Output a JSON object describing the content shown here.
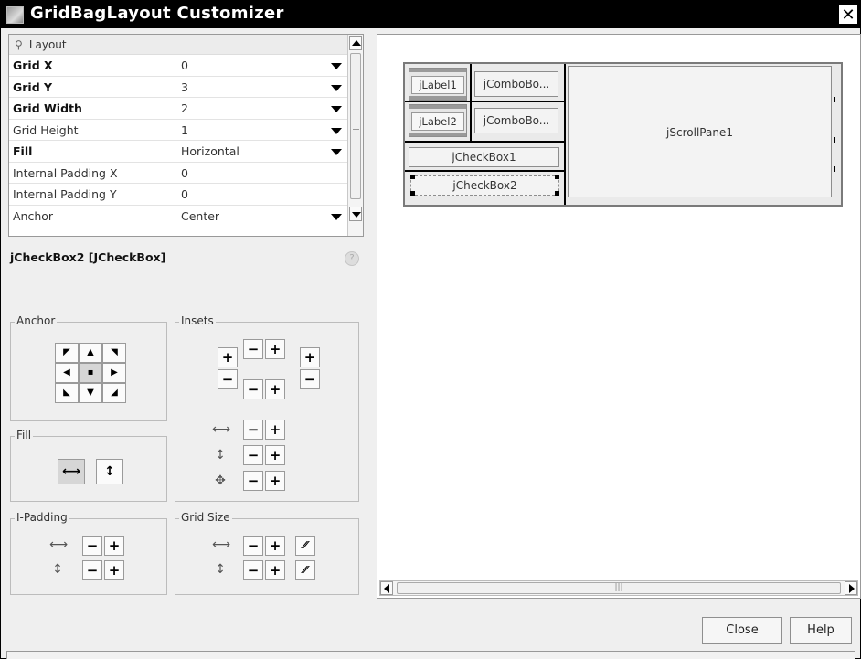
{
  "window": {
    "title": "GridBagLayout Customizer",
    "close_glyph": "✕",
    "app_icon": "window-icon"
  },
  "properties": {
    "header": "Layout",
    "rows": [
      {
        "key": "Grid X",
        "value": "0",
        "bold": true,
        "dropdown": true
      },
      {
        "key": "Grid Y",
        "value": "3",
        "bold": true,
        "dropdown": true
      },
      {
        "key": "Grid Width",
        "value": "2",
        "bold": true,
        "dropdown": true
      },
      {
        "key": "Grid Height",
        "value": "1",
        "bold": false,
        "dropdown": true
      },
      {
        "key": "Fill",
        "value": "Horizontal",
        "bold": true,
        "dropdown": true
      },
      {
        "key": "Internal Padding X",
        "value": "0",
        "bold": false,
        "dropdown": false
      },
      {
        "key": "Internal Padding Y",
        "value": "0",
        "bold": false,
        "dropdown": false
      },
      {
        "key": "Anchor",
        "value": "Center",
        "bold": false,
        "dropdown": true
      }
    ]
  },
  "component": {
    "label": "jCheckBox2 [JCheckBox]",
    "help": "?"
  },
  "groups": {
    "anchor": "Anchor",
    "insets": "Insets",
    "fill": "Fill",
    "ipadding": "I-Padding",
    "gridsize": "Grid Size"
  },
  "buttons": {
    "plus": "+",
    "minus": "−",
    "default": "⁄⁄"
  },
  "preview": {
    "cells": {
      "label1": "jLabel1",
      "combo1": "jComboBo...",
      "label2": "jLabel2",
      "combo2": "jComboBo...",
      "check1": "jCheckBox1",
      "check2": "jCheckBox2",
      "scroll": "jScrollPane1"
    },
    "scroll_thumb_grip": "|||"
  },
  "dialog": {
    "close": "Close",
    "help": "Help"
  }
}
